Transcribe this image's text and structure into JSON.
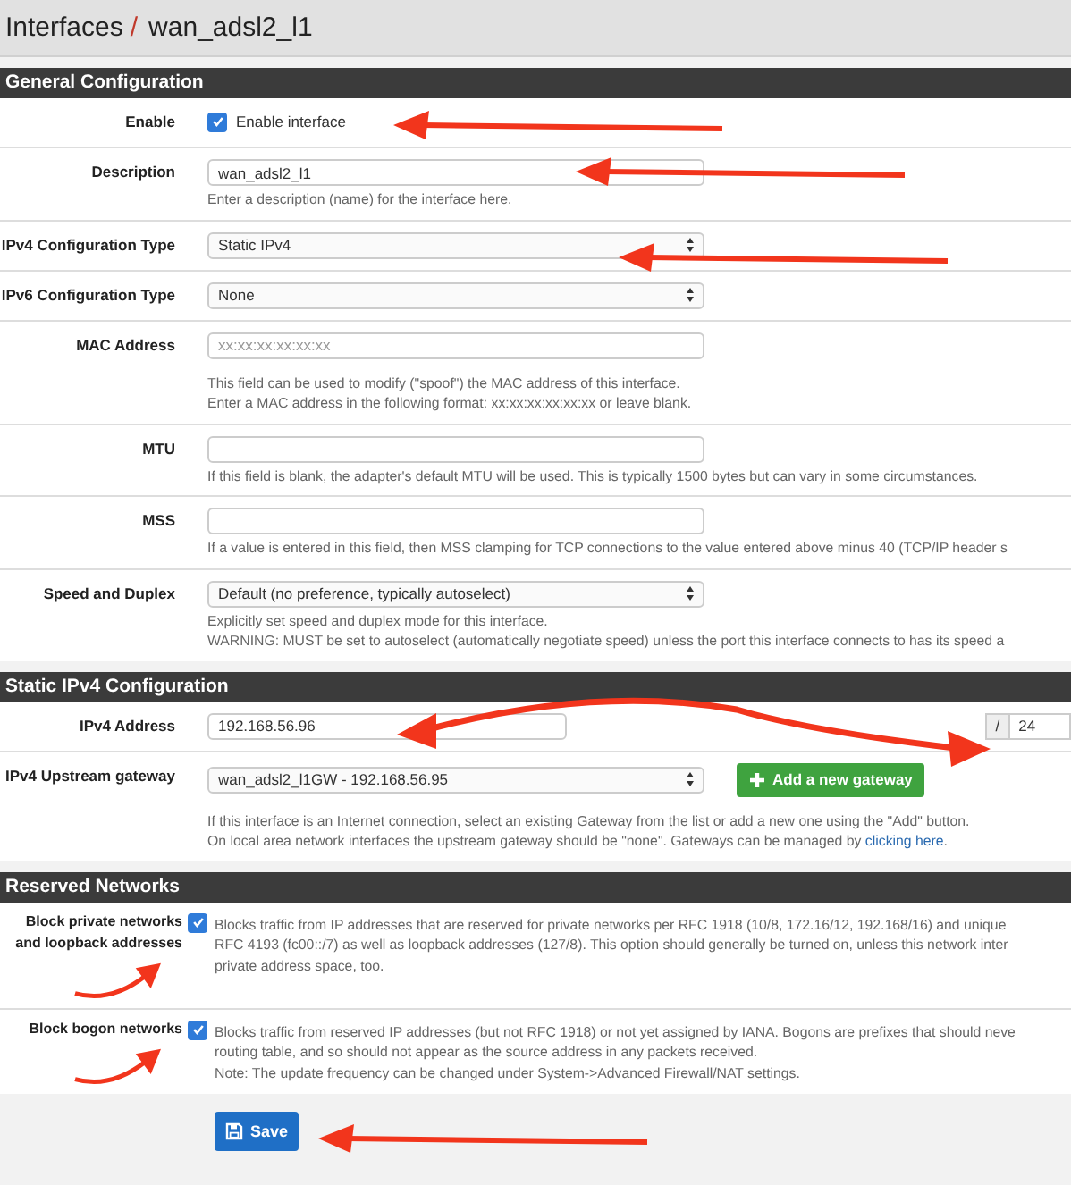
{
  "header": {
    "section": "Interfaces",
    "separator": "/",
    "page": "wan_adsl2_l1"
  },
  "sections": [
    {
      "title": "General Configuration",
      "rows": [
        {
          "kind": "checkbox",
          "label": "Enable",
          "checked": true,
          "text": "Enable interface",
          "arrow": {
            "kind": "straight"
          }
        },
        {
          "kind": "input",
          "label": "Description",
          "value": "wan_adsl2_l1",
          "help": [
            "Enter a description (name) for the interface here."
          ],
          "arrow": {
            "kind": "straight"
          }
        },
        {
          "kind": "select",
          "label": "IPv4 Configuration Type",
          "value": "Static IPv4",
          "arrow": {
            "kind": "straight"
          }
        },
        {
          "kind": "select",
          "label": "IPv6 Configuration Type",
          "value": "None"
        },
        {
          "kind": "input",
          "label": "MAC Address",
          "placeholder": "xx:xx:xx:xx:xx:xx",
          "help": [
            "This field can be used to modify (\"spoof\") the MAC address of this interface.",
            "Enter a MAC address in the following format: xx:xx:xx:xx:xx:xx or leave blank."
          ]
        },
        {
          "kind": "input",
          "label": "MTU",
          "help": [
            "If this field is blank, the adapter's default MTU will be used. This is typically 1500 bytes but can vary in some circumstances."
          ]
        },
        {
          "kind": "input",
          "label": "MSS",
          "help": [
            "If a value is entered in this field, then MSS clamping for TCP connections to the value entered above minus 40 (TCP/IP header s"
          ]
        },
        {
          "kind": "select",
          "label": "Speed and Duplex",
          "value": "Default (no preference, typically autoselect)",
          "help": [
            "Explicitly set speed and duplex mode for this interface.",
            "WARNING: MUST be set to autoselect (automatically negotiate speed) unless the port this interface connects to has its speed a"
          ]
        }
      ]
    },
    {
      "title": "Static IPv4 Configuration",
      "rows": [
        {
          "kind": "address",
          "label": "IPv4 Address",
          "value": "192.168.56.96",
          "separator": "/",
          "mask": "24",
          "arrow": {
            "kind": "double"
          }
        },
        {
          "kind": "gateway",
          "label": "IPv4 Upstream gateway",
          "value": "wan_adsl2_l1GW - 192.168.56.95",
          "button": "Add a new gateway",
          "help": [
            "If this interface is an Internet connection, select an existing Gateway from the list or add a new one using the \"Add\" button.",
            {
              "text": "On local area network interfaces the upstream gateway should be \"none\". Gateways can be managed by",
              "link": "clicking here",
              "after": "."
            }
          ]
        }
      ]
    },
    {
      "title": "Reserved Networks",
      "rows": [
        {
          "kind": "checkdesc",
          "label": "Block private networks and loopback addresses",
          "checked": true,
          "arrow": {
            "kind": "curved"
          },
          "help": [
            "Blocks traffic from IP addresses that are reserved for private networks per RFC 1918 (10/8, 172.16/12, 192.168/16) and unique",
            "RFC 4193 (fc00::/7) as well as loopback addresses (127/8). This option should generally be turned on, unless this network inter",
            "private address space, too."
          ]
        },
        {
          "kind": "checkdesc",
          "label": "Block bogon networks",
          "checked": true,
          "arrow": {
            "kind": "curved"
          },
          "help": [
            "Blocks traffic from reserved IP addresses (but not RFC 1918) or not yet assigned by IANA. Bogons are prefixes that should neve",
            "routing table, and so should not appear as the source address in any packets received.",
            "Note: The update frequency can be changed under System->Advanced Firewall/NAT settings."
          ]
        }
      ]
    }
  ],
  "save_button": {
    "label": "Save",
    "arrow": {
      "kind": "straight"
    }
  }
}
